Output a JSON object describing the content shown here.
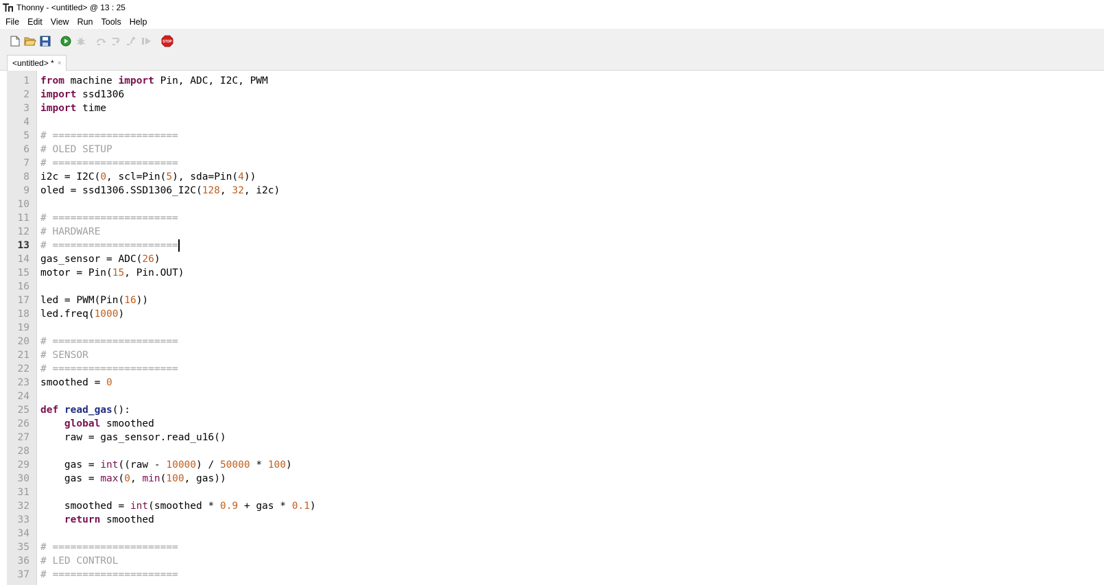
{
  "window": {
    "title": "Thonny  -  <untitled>  @  13 : 25"
  },
  "menu": [
    "File",
    "Edit",
    "View",
    "Run",
    "Tools",
    "Help"
  ],
  "toolbar": [
    {
      "name": "new-file-icon",
      "enabled": true
    },
    {
      "name": "open-file-icon",
      "enabled": true
    },
    {
      "name": "save-icon",
      "enabled": true
    },
    {
      "name": "run-icon",
      "enabled": true
    },
    {
      "name": "debug-icon",
      "enabled": false
    },
    {
      "name": "step-over-icon",
      "enabled": false
    },
    {
      "name": "step-into-icon",
      "enabled": false
    },
    {
      "name": "step-out-icon",
      "enabled": false
    },
    {
      "name": "resume-icon",
      "enabled": false
    },
    {
      "name": "stop-icon",
      "enabled": true,
      "label": "STOP"
    }
  ],
  "tab": {
    "label": "<untitled> *",
    "close": "×"
  },
  "editor": {
    "current_line": 13,
    "lines": [
      [
        [
          "kw",
          "from"
        ],
        [
          "t",
          " machine "
        ],
        [
          "kw",
          "import"
        ],
        [
          "t",
          " Pin, ADC, I2C, PWM"
        ]
      ],
      [
        [
          "kw",
          "import"
        ],
        [
          "t",
          " ssd1306"
        ]
      ],
      [
        [
          "kw",
          "import"
        ],
        [
          "t",
          " time"
        ]
      ],
      [],
      [
        [
          "cm",
          "# ====================="
        ]
      ],
      [
        [
          "cm",
          "# OLED SETUP"
        ]
      ],
      [
        [
          "cm",
          "# ====================="
        ]
      ],
      [
        [
          "t",
          "i2c = I2C("
        ],
        [
          "num",
          "0"
        ],
        [
          "t",
          ", scl=Pin("
        ],
        [
          "num",
          "5"
        ],
        [
          "t",
          "), sda=Pin("
        ],
        [
          "num",
          "4"
        ],
        [
          "t",
          "))"
        ]
      ],
      [
        [
          "t",
          "oled = ssd1306.SSD1306_I2C("
        ],
        [
          "num",
          "128"
        ],
        [
          "t",
          ", "
        ],
        [
          "num",
          "32"
        ],
        [
          "t",
          ", i2c)"
        ]
      ],
      [],
      [
        [
          "cm",
          "# ====================="
        ]
      ],
      [
        [
          "cm",
          "# HARDWARE"
        ]
      ],
      [
        [
          "cm",
          "# ====================="
        ]
      ],
      [
        [
          "t",
          "gas_sensor = ADC("
        ],
        [
          "num",
          "26"
        ],
        [
          "t",
          ")"
        ]
      ],
      [
        [
          "t",
          "motor = Pin("
        ],
        [
          "num",
          "15"
        ],
        [
          "t",
          ", Pin.OUT)"
        ]
      ],
      [],
      [
        [
          "t",
          "led = PWM(Pin("
        ],
        [
          "num",
          "16"
        ],
        [
          "t",
          "))"
        ]
      ],
      [
        [
          "t",
          "led.freq("
        ],
        [
          "num",
          "1000"
        ],
        [
          "t",
          ")"
        ]
      ],
      [],
      [
        [
          "cm",
          "# ====================="
        ]
      ],
      [
        [
          "cm",
          "# SENSOR"
        ]
      ],
      [
        [
          "cm",
          "# ====================="
        ]
      ],
      [
        [
          "t",
          "smoothed = "
        ],
        [
          "num",
          "0"
        ]
      ],
      [],
      [
        [
          "kw",
          "def"
        ],
        [
          "t",
          " "
        ],
        [
          "fn",
          "read_gas"
        ],
        [
          "t",
          "():"
        ]
      ],
      [
        [
          "t",
          "    "
        ],
        [
          "kw",
          "global"
        ],
        [
          "t",
          " smoothed"
        ]
      ],
      [
        [
          "t",
          "    raw = gas_sensor.read_u16()"
        ]
      ],
      [],
      [
        [
          "t",
          "    gas = "
        ],
        [
          "bi",
          "int"
        ],
        [
          "t",
          "((raw - "
        ],
        [
          "num",
          "10000"
        ],
        [
          "t",
          ") / "
        ],
        [
          "num",
          "50000"
        ],
        [
          "t",
          " * "
        ],
        [
          "num",
          "100"
        ],
        [
          "t",
          ")"
        ]
      ],
      [
        [
          "t",
          "    gas = "
        ],
        [
          "bi",
          "max"
        ],
        [
          "t",
          "("
        ],
        [
          "num",
          "0"
        ],
        [
          "t",
          ", "
        ],
        [
          "bi",
          "min"
        ],
        [
          "t",
          "("
        ],
        [
          "num",
          "100"
        ],
        [
          "t",
          ", gas))"
        ]
      ],
      [],
      [
        [
          "t",
          "    smoothed = "
        ],
        [
          "bi",
          "int"
        ],
        [
          "t",
          "(smoothed * "
        ],
        [
          "num",
          "0.9"
        ],
        [
          "t",
          " + gas * "
        ],
        [
          "num",
          "0.1"
        ],
        [
          "t",
          ")"
        ]
      ],
      [
        [
          "t",
          "    "
        ],
        [
          "kw",
          "return"
        ],
        [
          "t",
          " smoothed"
        ]
      ],
      [],
      [
        [
          "cm",
          "# ====================="
        ]
      ],
      [
        [
          "cm",
          "# LED CONTROL"
        ]
      ],
      [
        [
          "cm",
          "# ====================="
        ]
      ]
    ]
  }
}
